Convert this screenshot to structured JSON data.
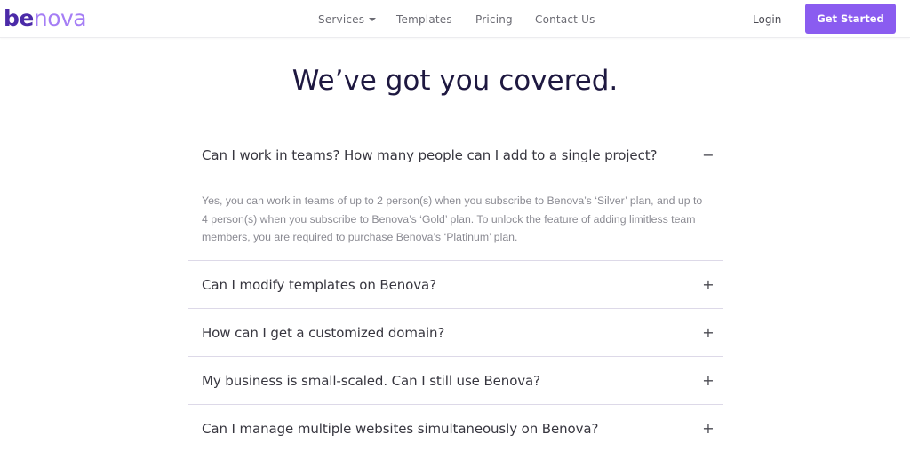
{
  "brand": {
    "logo_part1": "be",
    "logo_part2": "nova",
    "colors": {
      "primary": "#8a5cf0",
      "logo_dark": "#4b2aa8",
      "logo_light": "#a57ef5",
      "heading": "#1e1840"
    }
  },
  "nav": {
    "links": [
      {
        "label": "Services",
        "has_dropdown": true
      },
      {
        "label": "Templates"
      },
      {
        "label": "Pricing"
      },
      {
        "label": "Contact Us"
      }
    ],
    "login_label": "Login",
    "cta_label": "Get Started"
  },
  "main": {
    "title": "We’ve got you covered.",
    "faq": [
      {
        "question": "Can I work in teams? How many people can I add to a single project?",
        "expanded": true,
        "toggle_icon": "−",
        "answer": "Yes, you can work in teams of up to 2 person(s) when you subscribe to Benova’s ‘Silver’ plan, and up to 4 person(s) when you subscribe to Benova’s ‘Gold’ plan. To unlock the feature of adding limitless team members, you are required to purchase Benova’s ‘Platinum’ plan."
      },
      {
        "question": "Can I modify templates on Benova?",
        "expanded": false,
        "toggle_icon": "+"
      },
      {
        "question": "How can I get a customized domain?",
        "expanded": false,
        "toggle_icon": "+"
      },
      {
        "question": "My business is small-scaled. Can I still use Benova?",
        "expanded": false,
        "toggle_icon": "+"
      },
      {
        "question": "Can I manage multiple websites simultaneously on Benova?",
        "expanded": false,
        "toggle_icon": "+"
      }
    ]
  }
}
